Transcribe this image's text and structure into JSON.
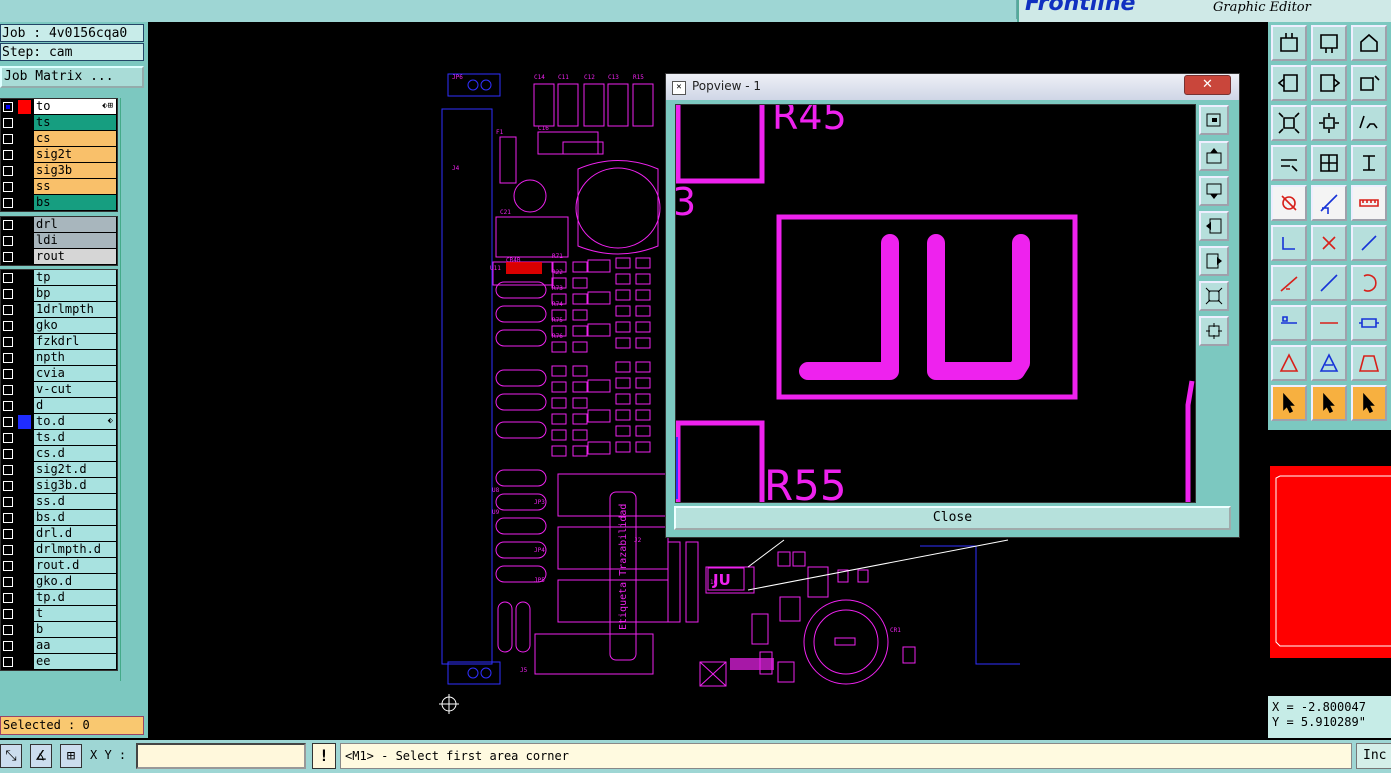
{
  "brand": {
    "logo_text": "Frontline",
    "subtitle": "Graphic Editor"
  },
  "job": {
    "job_line": "Job : 4v0156cqa0",
    "step_line": "Step: cam",
    "matrix_button": "Job Matrix ..."
  },
  "layers": {
    "group1": [
      {
        "name": "to",
        "color": "#ffffff",
        "swatch": "#ff0000",
        "checked": true,
        "marker": "⬖⊞"
      },
      {
        "name": "ts",
        "color": "#169e80",
        "swatch": "#000000",
        "checked": false,
        "marker": ""
      },
      {
        "name": "cs",
        "color": "#f9c06a",
        "swatch": "#000000",
        "checked": false,
        "marker": ""
      },
      {
        "name": "sig2t",
        "color": "#f9c06a",
        "swatch": "#000000",
        "checked": false,
        "marker": ""
      },
      {
        "name": "sig3b",
        "color": "#f9c06a",
        "swatch": "#000000",
        "checked": false,
        "marker": ""
      },
      {
        "name": "ss",
        "color": "#f9c06a",
        "swatch": "#000000",
        "checked": false,
        "marker": ""
      },
      {
        "name": "bs",
        "color": "#169e80",
        "swatch": "#000000",
        "checked": false,
        "marker": ""
      }
    ],
    "group2": [
      {
        "name": "drl",
        "color": "#a8b6bd",
        "swatch": "#000000",
        "checked": false,
        "marker": ""
      },
      {
        "name": "ldi",
        "color": "#a8b6bd",
        "swatch": "#000000",
        "checked": false,
        "marker": ""
      },
      {
        "name": "rout",
        "color": "#d6d6d6",
        "swatch": "#000000",
        "checked": false,
        "marker": ""
      }
    ],
    "group3": [
      {
        "name": "tp",
        "color": "#a8e2e0",
        "swatch": "#000000",
        "checked": false,
        "marker": ""
      },
      {
        "name": "bp",
        "color": "#a8e2e0",
        "swatch": "#000000",
        "checked": false,
        "marker": ""
      },
      {
        "name": "1drlmpth",
        "color": "#a8e2e0",
        "swatch": "#000000",
        "checked": false,
        "marker": ""
      },
      {
        "name": "gko",
        "color": "#a8e2e0",
        "swatch": "#000000",
        "checked": false,
        "marker": ""
      },
      {
        "name": "fzkdrl",
        "color": "#a8e2e0",
        "swatch": "#000000",
        "checked": false,
        "marker": ""
      },
      {
        "name": "npth",
        "color": "#a8e2e0",
        "swatch": "#000000",
        "checked": false,
        "marker": ""
      },
      {
        "name": "cvia",
        "color": "#a8e2e0",
        "swatch": "#000000",
        "checked": false,
        "marker": ""
      },
      {
        "name": "v-cut",
        "color": "#a8e2e0",
        "swatch": "#000000",
        "checked": false,
        "marker": ""
      },
      {
        "name": "d",
        "color": "#a8e2e0",
        "swatch": "#000000",
        "checked": false,
        "marker": ""
      },
      {
        "name": "to.d",
        "color": "#a8e2e0",
        "swatch": "#1f2cff",
        "checked": false,
        "marker": "⬖"
      },
      {
        "name": "ts.d",
        "color": "#a8e2e0",
        "swatch": "#000000",
        "checked": false,
        "marker": ""
      },
      {
        "name": "cs.d",
        "color": "#a8e2e0",
        "swatch": "#000000",
        "checked": false,
        "marker": ""
      },
      {
        "name": "sig2t.d",
        "color": "#a8e2e0",
        "swatch": "#000000",
        "checked": false,
        "marker": ""
      },
      {
        "name": "sig3b.d",
        "color": "#a8e2e0",
        "swatch": "#000000",
        "checked": false,
        "marker": ""
      },
      {
        "name": "ss.d",
        "color": "#a8e2e0",
        "swatch": "#000000",
        "checked": false,
        "marker": ""
      },
      {
        "name": "bs.d",
        "color": "#a8e2e0",
        "swatch": "#000000",
        "checked": false,
        "marker": ""
      },
      {
        "name": "drl.d",
        "color": "#a8e2e0",
        "swatch": "#000000",
        "checked": false,
        "marker": ""
      },
      {
        "name": "drlmpth.d",
        "color": "#a8e2e0",
        "swatch": "#000000",
        "checked": false,
        "marker": ""
      },
      {
        "name": "rout.d",
        "color": "#a8e2e0",
        "swatch": "#000000",
        "checked": false,
        "marker": ""
      },
      {
        "name": "gko.d",
        "color": "#a8e2e0",
        "swatch": "#000000",
        "checked": false,
        "marker": ""
      },
      {
        "name": "tp.d",
        "color": "#a8e2e0",
        "swatch": "#000000",
        "checked": false,
        "marker": ""
      },
      {
        "name": "t",
        "color": "#a8e2e0",
        "swatch": "#000000",
        "checked": false,
        "marker": ""
      },
      {
        "name": "b",
        "color": "#a8e2e0",
        "swatch": "#000000",
        "checked": false,
        "marker": ""
      },
      {
        "name": "aa",
        "color": "#a8e2e0",
        "swatch": "#000000",
        "checked": false,
        "marker": ""
      },
      {
        "name": "ee",
        "color": "#a8e2e0",
        "swatch": "#000000",
        "checked": false,
        "marker": ""
      }
    ]
  },
  "selected": "Selected : 0",
  "bottom": {
    "xy_label": "X Y :",
    "xy_value": "",
    "info_button": "!",
    "status": "<M1> - Select first area corner",
    "inc_button": "Inc"
  },
  "coords": {
    "x": "X = -2.800047",
    "y": "Y = 5.910289\""
  },
  "popview": {
    "title": "Popview - 1",
    "close_x": "✕",
    "close_button": "Close",
    "labels": {
      "r45": "R45",
      "r55": "R55",
      "partial3": "3",
      "mark": "JU"
    }
  },
  "board": {
    "refs": [
      "C14",
      "C11",
      "C12",
      "C13",
      "R15",
      "C16",
      "F1",
      "C21",
      "U11",
      "CR4B",
      "R71",
      "R22",
      "R73",
      "R74",
      "R75",
      "R76",
      "U8",
      "U9",
      "JP3",
      "JP4",
      "JP5",
      "JP6",
      "J4",
      "J2",
      "J5",
      "CR1",
      "16",
      "JU"
    ],
    "side_label": "Etiqueta Trazabilidad"
  },
  "colors": {
    "layer_magenta": "#ee22ee",
    "outline_blue": "#3030ff",
    "accent_red": "#ff0000",
    "panel": "#7cc8c0"
  }
}
